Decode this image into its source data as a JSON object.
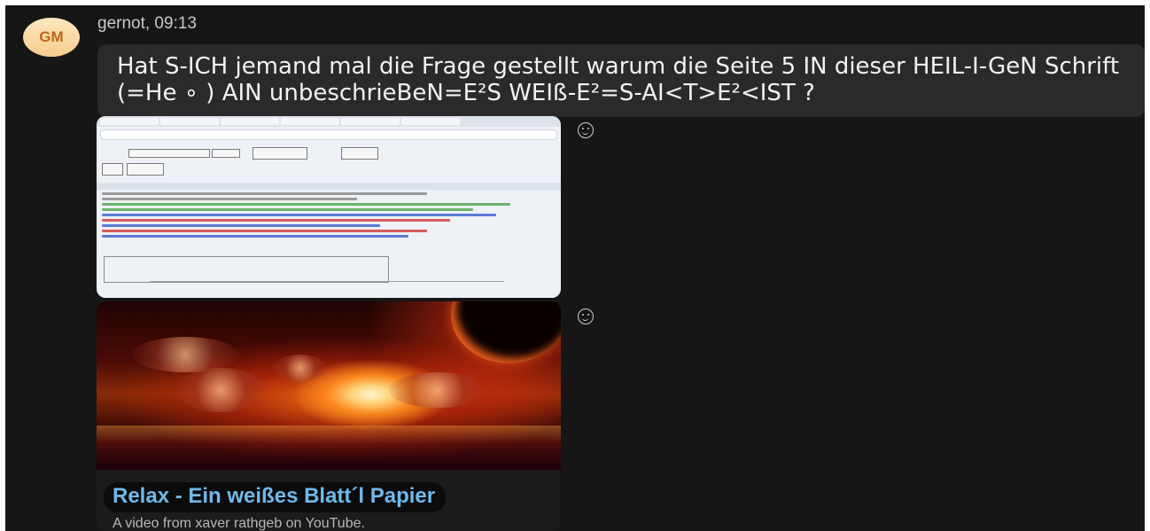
{
  "message": {
    "avatar_initials": "GM",
    "sender": "gernot",
    "time": "09:13",
    "header": "gernot, 09:13",
    "text": "Hat S-ICH jemand mal die Frage gestellt warum die Seite 5 IN dieser HEIL-I-GeN Schrift (=He ∘ ) AIN unbeschrieBeN=E²S WEIß-E²=S-AI<T>E²<IST ?"
  },
  "attachments": {
    "screenshot_image": "gematria-calculator-screenshot",
    "reaction_icon": "smiley-face-icon"
  },
  "link_preview": {
    "title": "Relax - Ein weißes Blatt´l Papier",
    "description": "A video from xaver rathgeb on YouTube.",
    "thumbnail": "cosmic-sunset-icon"
  },
  "colors": {
    "background": "#161616",
    "bubble": "#2a2a2a",
    "avatar": "#f6cd8e",
    "link_title": "#6fb9ea"
  }
}
